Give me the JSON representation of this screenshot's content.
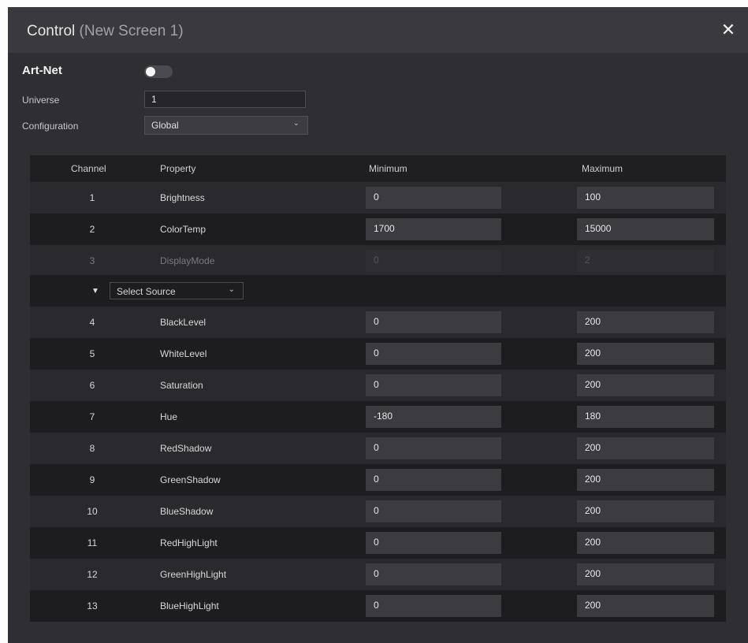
{
  "dialog": {
    "title": "Control",
    "subtitle": "(New Screen 1)",
    "close_glyph": "✕"
  },
  "artnet": {
    "label": "Art-Net",
    "enabled": false
  },
  "universe": {
    "label": "Universe",
    "value": "1"
  },
  "configuration": {
    "label": "Configuration",
    "value": "Global",
    "chevron": "⌄"
  },
  "table": {
    "headers": {
      "channel": "Channel",
      "property": "Property",
      "minimum": "Minimum",
      "maximum": "Maximum"
    },
    "rows_top": [
      {
        "channel": "1",
        "property": "Brightness",
        "min": "0",
        "max": "100"
      },
      {
        "channel": "2",
        "property": "ColorTemp",
        "min": "1700",
        "max": "15000"
      },
      {
        "channel": "3",
        "property": "DisplayMode",
        "min": "0",
        "max": "2"
      }
    ],
    "source": {
      "arrow": "▼",
      "label": "Select Source",
      "chevron": "⌄"
    },
    "rows_bottom": [
      {
        "channel": "4",
        "property": "BlackLevel",
        "min": "0",
        "max": "200"
      },
      {
        "channel": "5",
        "property": "WhiteLevel",
        "min": "0",
        "max": "200"
      },
      {
        "channel": "6",
        "property": "Saturation",
        "min": "0",
        "max": "200"
      },
      {
        "channel": "7",
        "property": "Hue",
        "min": "-180",
        "max": "180"
      },
      {
        "channel": "8",
        "property": "RedShadow",
        "min": "0",
        "max": "200"
      },
      {
        "channel": "9",
        "property": "GreenShadow",
        "min": "0",
        "max": "200"
      },
      {
        "channel": "10",
        "property": "BlueShadow",
        "min": "0",
        "max": "200"
      },
      {
        "channel": "11",
        "property": "RedHighLight",
        "min": "0",
        "max": "200"
      },
      {
        "channel": "12",
        "property": "GreenHighLight",
        "min": "0",
        "max": "200"
      },
      {
        "channel": "13",
        "property": "BlueHighLight",
        "min": "0",
        "max": "200"
      }
    ]
  },
  "colors": {
    "dialog_bg": "#2f2f33",
    "titlebar_bg": "#3a3a3e",
    "row_odd": "#2a2a2e",
    "row_even": "#1d1d20",
    "input_bg": "#3b3b40"
  }
}
